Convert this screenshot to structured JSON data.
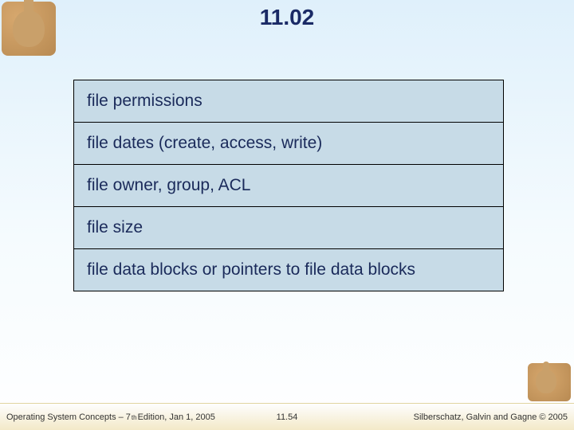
{
  "title": "11.02",
  "rows": [
    "file permissions",
    "file dates (create, access, write)",
    "file owner, group, ACL",
    "file size",
    "file data blocks or pointers to file data blocks"
  ],
  "footer": {
    "left_prefix": "Operating System Concepts – 7",
    "left_sup": "th",
    "left_suffix": " Edition, Jan 1, 2005",
    "center": "11.54",
    "right": "Silberschatz, Galvin and Gagne © 2005"
  }
}
